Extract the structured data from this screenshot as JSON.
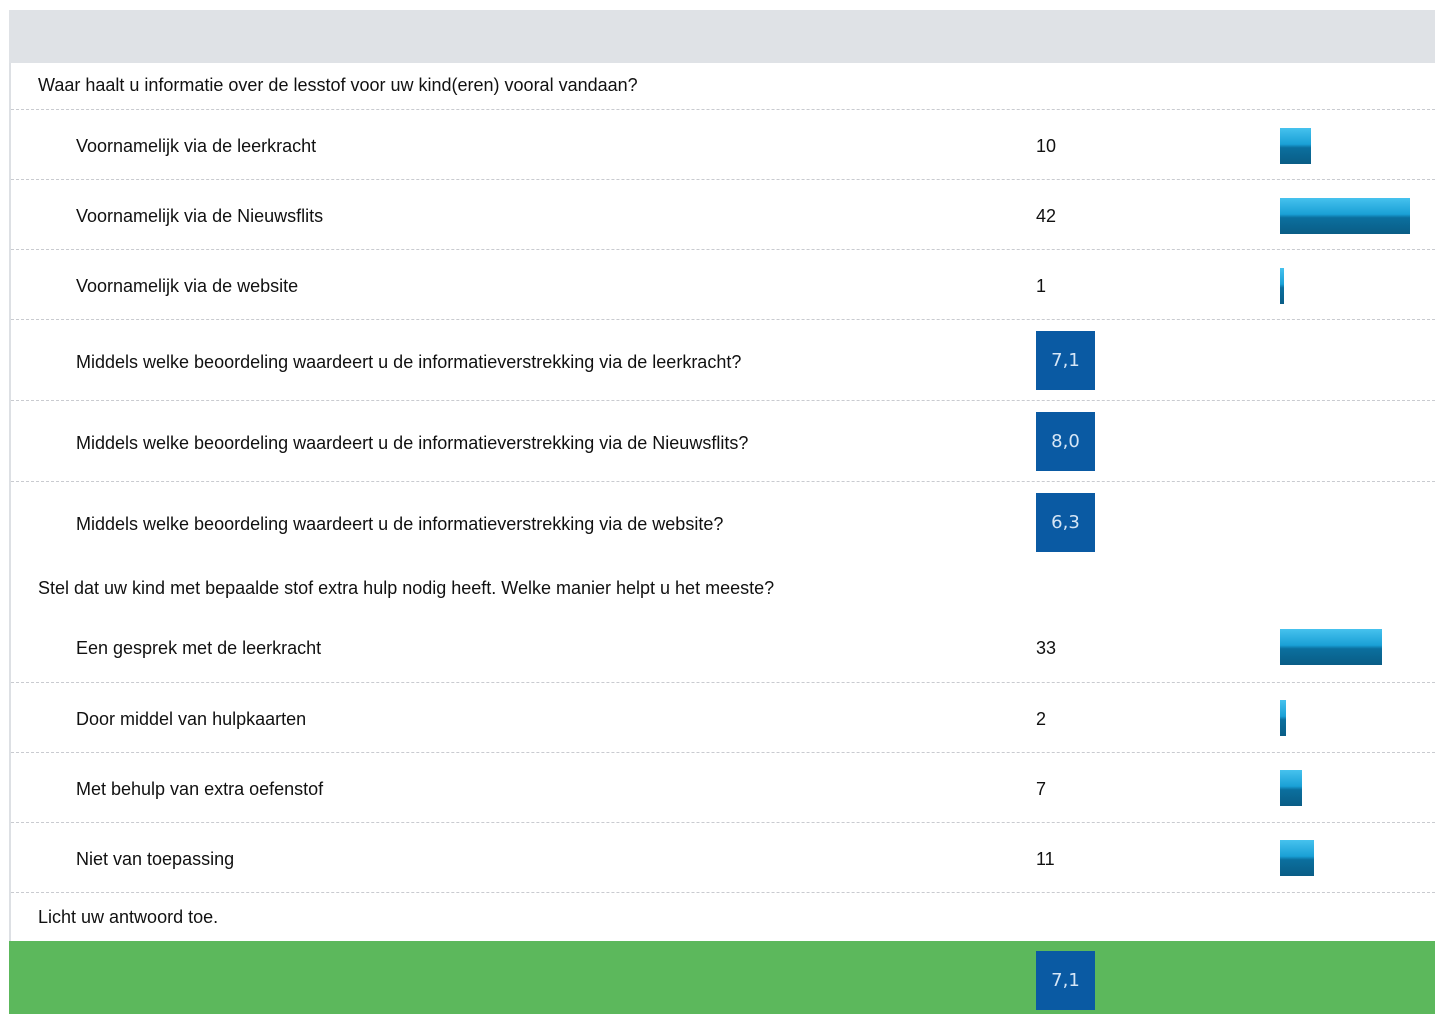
{
  "question1": {
    "title": "Waar haalt u informatie over de lesstof voor uw kind(eren) vooral vandaan?",
    "answers": [
      {
        "label": "Voornamelijk via de leerkracht",
        "count": "10",
        "value": 10
      },
      {
        "label": "Voornamelijk via de Nieuwsflits",
        "count": "42",
        "value": 42
      },
      {
        "label": "Voornamelijk via de website",
        "count": "1",
        "value": 1
      }
    ],
    "ratings": [
      {
        "label": "Middels welke beoordeling waardeert u de informatieverstrekking via de leerkracht?",
        "score": "7,1"
      },
      {
        "label": "Middels welke beoordeling waardeert u de informatieverstrekking via de Nieuwsflits?",
        "score": "8,0"
      },
      {
        "label": "Middels welke beoordeling waardeert u de informatieverstrekking via de website?",
        "score": "6,3"
      }
    ]
  },
  "question2": {
    "title": "Stel dat uw kind met bepaalde stof extra hulp nodig heeft. Welke manier helpt u het meeste?",
    "answers": [
      {
        "label": "Een gesprek met de leerkracht",
        "count": "33",
        "value": 33
      },
      {
        "label": "Door middel van hulpkaarten",
        "count": "2",
        "value": 2
      },
      {
        "label": "Met behulp van extra oefenstof",
        "count": "7",
        "value": 7
      },
      {
        "label": "Niet van toepassing",
        "count": "11",
        "value": 11
      }
    ]
  },
  "question3": {
    "title": "Licht uw antwoord toe."
  },
  "summary": {
    "score": "7,1"
  },
  "colors": {
    "header": "#dfe2e6",
    "score_box": "#0a5aa3",
    "summary_band": "#5cb85c",
    "bar_top": "#46c2ee",
    "bar_bottom": "#0a5d86"
  },
  "bar_max_value": 42
}
